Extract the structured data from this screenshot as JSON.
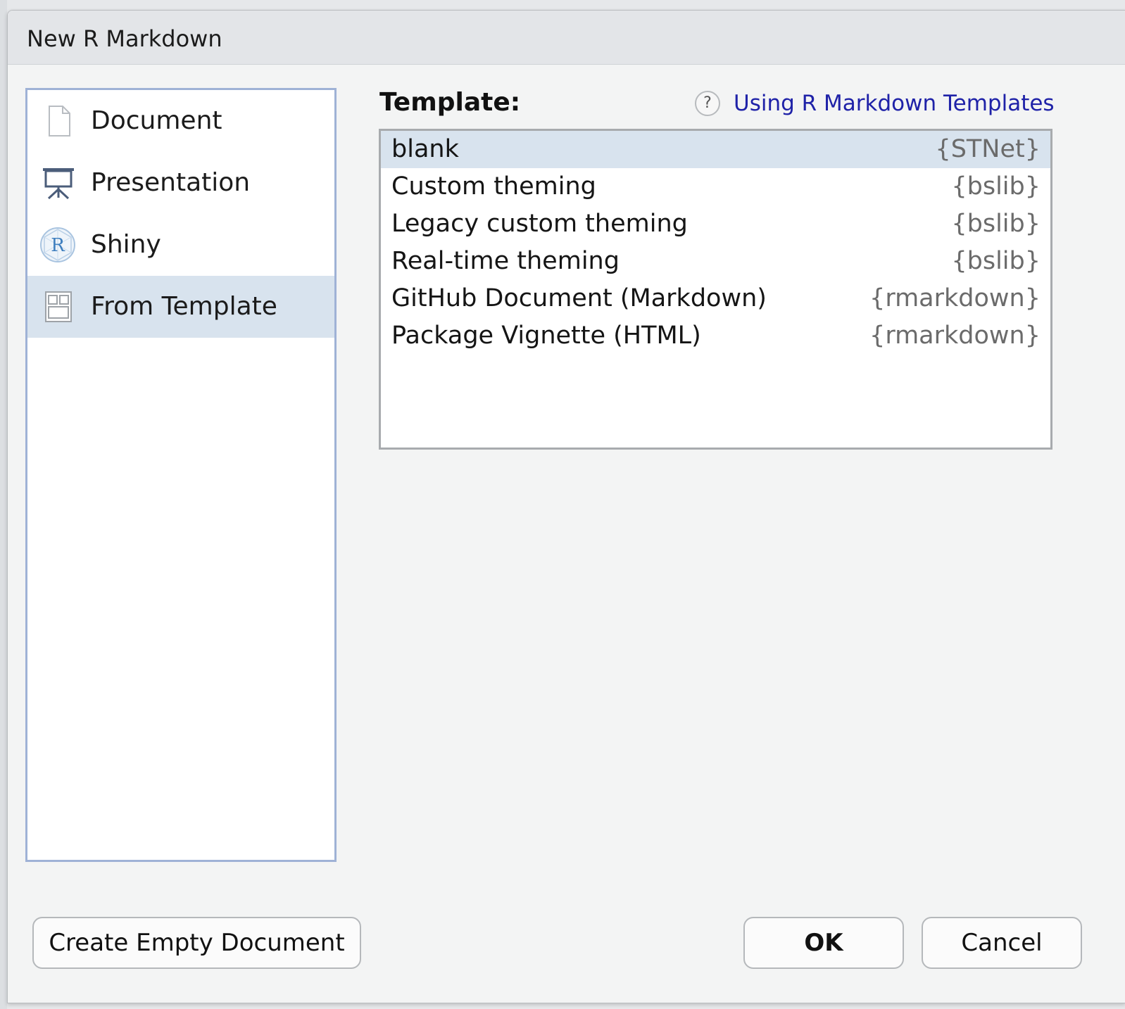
{
  "dialog": {
    "title": "New R Markdown"
  },
  "categories": [
    {
      "label": "Document",
      "icon": "document-icon"
    },
    {
      "label": "Presentation",
      "icon": "presentation-icon"
    },
    {
      "label": "Shiny",
      "icon": "shiny-icon"
    },
    {
      "label": "From Template",
      "icon": "template-icon",
      "selected": true
    }
  ],
  "template_panel": {
    "label": "Template:",
    "help_link": "Using R Markdown Templates",
    "help_icon": "?"
  },
  "templates": [
    {
      "name": "blank",
      "package": "{STNet}",
      "selected": true
    },
    {
      "name": "Custom theming",
      "package": "{bslib}"
    },
    {
      "name": "Legacy custom theming",
      "package": "{bslib}"
    },
    {
      "name": "Real-time theming",
      "package": "{bslib}"
    },
    {
      "name": "GitHub Document (Markdown)",
      "package": "{rmarkdown}"
    },
    {
      "name": "Package Vignette (HTML)",
      "package": "{rmarkdown}"
    }
  ],
  "buttons": {
    "create_empty": "Create Empty Document",
    "ok": "OK",
    "cancel": "Cancel"
  },
  "colors": {
    "selection": "#d8e3ee",
    "link": "#1f22a8",
    "list_border": "#9fb2d6"
  }
}
